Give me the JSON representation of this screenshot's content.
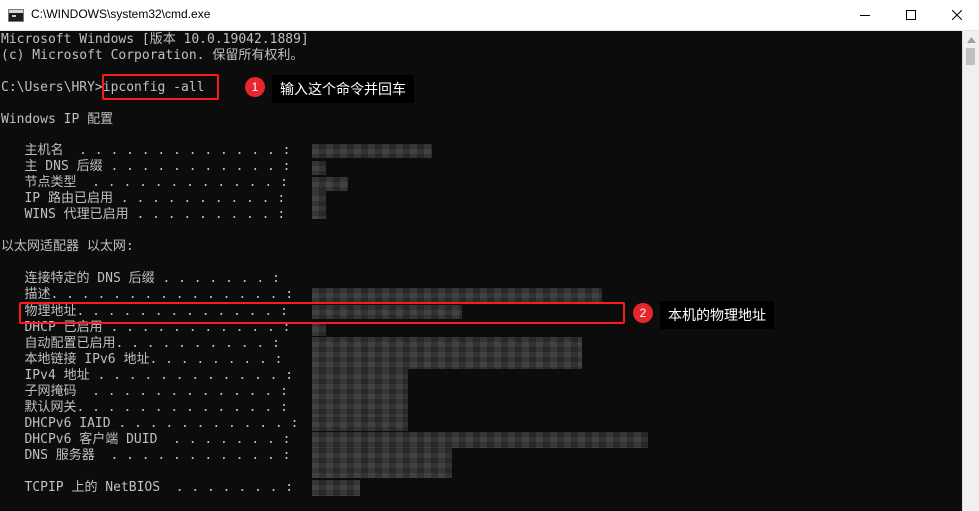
{
  "window": {
    "title": "C:\\WINDOWS\\system32\\cmd.exe",
    "icon": "cmd-icon",
    "controls": [
      "minimize-icon",
      "maximize-icon",
      "close-icon"
    ]
  },
  "console": {
    "lines": [
      "Microsoft Windows [版本 10.0.19042.1889]",
      "(c) Microsoft Corporation. 保留所有权利。",
      "",
      "C:\\Users\\HRY>ipconfig -all",
      "",
      "Windows IP 配置",
      "",
      "   主机名  . . . . . . . . . . . . . :",
      "   主 DNS 后缀 . . . . . . . . . . . :",
      "   节点类型  . . . . . . . . . . . . :",
      "   IP 路由已启用 . . . . . . . . . . :",
      "   WINS 代理已启用 . . . . . . . . . :",
      "",
      "以太网适配器 以太网:",
      "",
      "   连接特定的 DNS 后缀 . . . . . . . :",
      "   描述. . . . . . . . . . . . . . . :",
      "   物理地址. . . . . . . . . . . . . :",
      "   DHCP 已启用 . . . . . . . . . . . :",
      "   自动配置已启用. . . . . . . . . . :",
      "   本地链接 IPv6 地址. . . . . . . . :",
      "   IPv4 地址 . . . . . . . . . . . . :",
      "   子网掩码  . . . . . . . . . . . . :",
      "   默认网关. . . . . . . . . . . . . :",
      "   DHCPv6 IAID . . . . . . . . . . . :",
      "   DHCPv6 客户端 DUID  . . . . . . . :",
      "   DNS 服务器  . . . . . . . . . . . :",
      "",
      "   TCPIP 上的 NetBIOS  . . . . . . . :"
    ]
  },
  "annotations": [
    {
      "number": "1",
      "text": "输入这个命令并回车"
    },
    {
      "number": "2",
      "text": "本机的物理地址"
    }
  ],
  "colors": {
    "console_bg": "#0c0c0c",
    "console_text": "#c0c0c0",
    "highlight": "#ff1a1a",
    "badge": "#e8262d"
  }
}
